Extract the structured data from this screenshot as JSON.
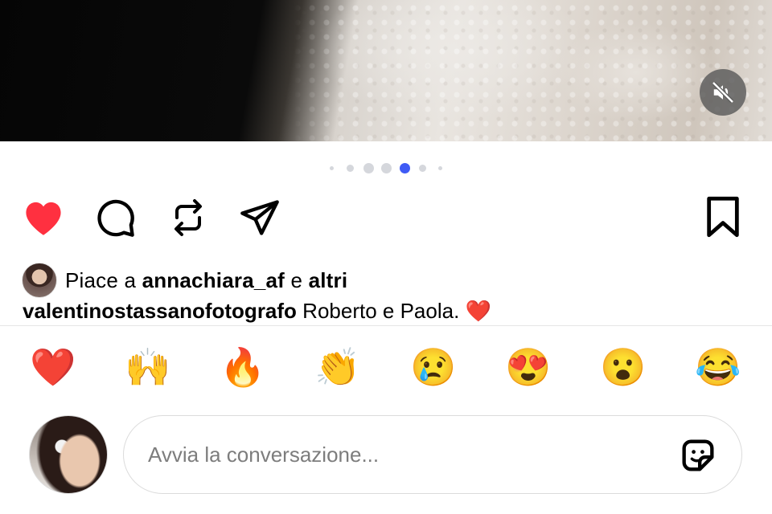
{
  "media": {
    "mute_icon": "speaker-muted-icon"
  },
  "carousel": {
    "count": 7,
    "active_index": 4,
    "accent": "#3f5bf5",
    "inactive": "#d5d7dc"
  },
  "actions": {
    "like_icon": "heart-filled-icon",
    "like_color": "#ff3040",
    "comment_icon": "comment-bubble-icon",
    "repost_icon": "repost-icon",
    "share_icon": "paper-plane-icon",
    "save_icon": "bookmark-icon"
  },
  "likes": {
    "prefix": "Piace a",
    "user": "annachiara_af",
    "conjunction": "e",
    "others": "altri"
  },
  "caption": {
    "username": "valentinostassanofotografo",
    "text": "Roberto e Paola.",
    "emoji": "❤️"
  },
  "reactions": [
    "❤️",
    "🙌",
    "🔥",
    "👏",
    "😢",
    "😍",
    "😮",
    "😂"
  ],
  "comment": {
    "placeholder": "Avvia la conversazione...",
    "sticker_icon": "sticker-icon"
  }
}
